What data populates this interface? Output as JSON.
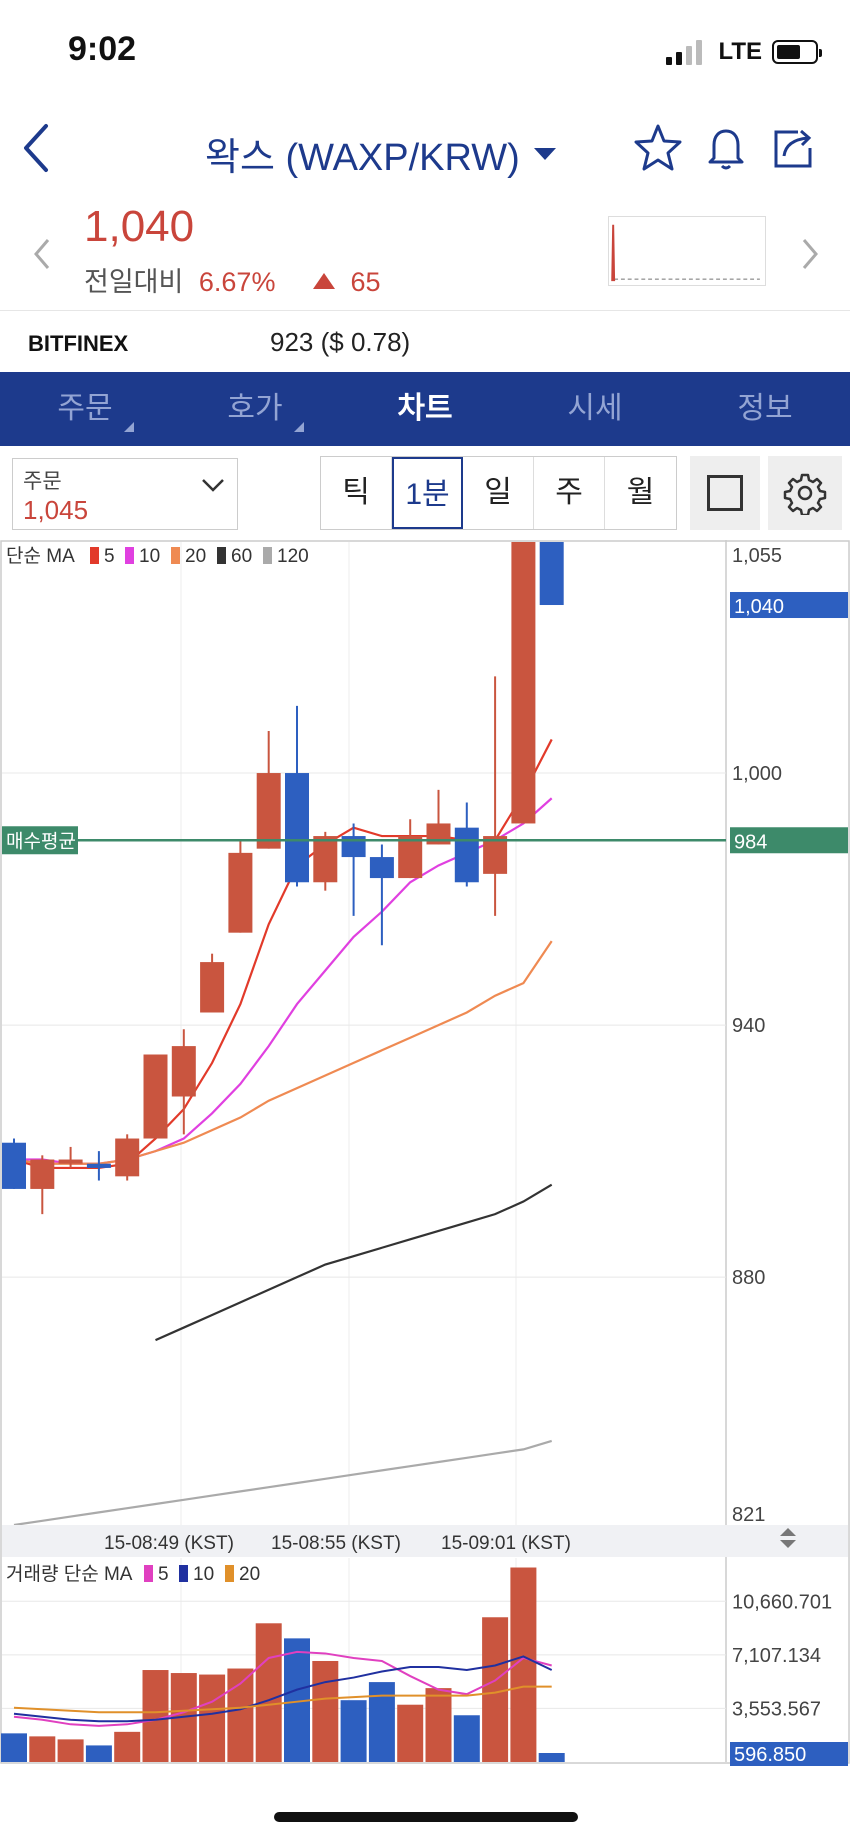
{
  "status": {
    "time": "9:02",
    "network": "LTE"
  },
  "header": {
    "title": "왁스 (WAXP/KRW)"
  },
  "quote": {
    "price": "1,040",
    "change_label": "전일대비",
    "change_pct": "6.67%",
    "change_abs": "65"
  },
  "exchange": {
    "name": "BITFINEX",
    "value": "923 ($ 0.78)"
  },
  "tabs": [
    {
      "label": "주문"
    },
    {
      "label": "호가"
    },
    {
      "label": "차트"
    },
    {
      "label": "시세"
    },
    {
      "label": "정보"
    }
  ],
  "order_box": {
    "label": "주문",
    "value": "1,045"
  },
  "periods": [
    "틱",
    "1분",
    "일",
    "주",
    "월"
  ],
  "selected_period": "1분",
  "colors": {
    "up": "#c9553f",
    "down": "#2d5fc0",
    "brand": "#1d3a8c",
    "avg": "#3d8a6a"
  },
  "chart_data": [
    {
      "type": "candlestick",
      "legend_title": "단순 MA",
      "ma_legend": [
        {
          "name": "5",
          "color": "#e23a2a"
        },
        {
          "name": "10",
          "color": "#e040e0"
        },
        {
          "name": "20",
          "color": "#ef8a52"
        },
        {
          "name": "60",
          "color": "#333333"
        },
        {
          "name": "120",
          "color": "#aaaaaa"
        }
      ],
      "ylim": [
        821,
        1055
      ],
      "yticks": [
        "1,055",
        "1,000",
        "940",
        "880",
        "821"
      ],
      "current_price_label": "1,040",
      "avg_price": {
        "label": "매수평균",
        "value": 984,
        "tag": "984"
      },
      "xticks": [
        "15-08:49 (KST)",
        "15-08:55 (KST)",
        "15-09:01 (KST)"
      ],
      "candles": [
        {
          "o": 912,
          "c": 901,
          "h": 913,
          "l": 901
        },
        {
          "o": 901,
          "c": 908,
          "h": 909,
          "l": 895
        },
        {
          "o": 907,
          "c": 908,
          "h": 911,
          "l": 906
        },
        {
          "o": 907,
          "c": 906,
          "h": 910,
          "l": 903
        },
        {
          "o": 904,
          "c": 913,
          "h": 914,
          "l": 903
        },
        {
          "o": 913,
          "c": 933,
          "h": 933,
          "l": 913
        },
        {
          "o": 923,
          "c": 935,
          "h": 939,
          "l": 914
        },
        {
          "o": 943,
          "c": 955,
          "h": 957,
          "l": 943
        },
        {
          "o": 962,
          "c": 981,
          "h": 984,
          "l": 962
        },
        {
          "o": 982,
          "c": 1000,
          "h": 1010,
          "l": 982
        },
        {
          "o": 1000,
          "c": 974,
          "h": 1016,
          "l": 973
        },
        {
          "o": 974,
          "c": 985,
          "h": 986,
          "l": 972
        },
        {
          "o": 985,
          "c": 980,
          "h": 988,
          "l": 966
        },
        {
          "o": 980,
          "c": 975,
          "h": 983,
          "l": 959
        },
        {
          "o": 975,
          "c": 985,
          "h": 989,
          "l": 975
        },
        {
          "o": 983,
          "c": 988,
          "h": 996,
          "l": 983
        },
        {
          "o": 987,
          "c": 974,
          "h": 993,
          "l": 973
        },
        {
          "o": 976,
          "c": 985,
          "h": 1023,
          "l": 966
        },
        {
          "o": 988,
          "c": 1055,
          "h": 1055,
          "l": 988
        },
        {
          "o": 1055,
          "c": 1040,
          "h": 1055,
          "l": 1040
        }
      ],
      "ma": [
        {
          "name": "5",
          "color": "#e23a2a",
          "values": [
            908,
            906,
            906,
            906,
            907,
            913,
            920,
            931,
            945,
            964,
            978,
            983,
            987,
            985,
            985,
            985,
            984,
            984,
            995,
            1008
          ]
        },
        {
          "name": "10",
          "color": "#e040e0",
          "values": [
            908,
            908,
            907,
            907,
            908,
            910,
            913,
            919,
            926,
            935,
            945,
            953,
            961,
            967,
            974,
            978,
            981,
            984,
            988,
            994
          ]
        },
        {
          "name": "20",
          "color": "#ef8a52",
          "values": [
            908,
            907,
            907,
            907,
            908,
            910,
            912,
            915,
            918,
            922,
            925,
            928,
            931,
            934,
            937,
            940,
            943,
            947,
            950,
            960
          ]
        },
        {
          "name": "60",
          "color": "#333333",
          "values": [
            854,
            856,
            858,
            860,
            862,
            865,
            868,
            871,
            874,
            877,
            880,
            883,
            885,
            887,
            889,
            891,
            893,
            895,
            898,
            902
          ]
        },
        {
          "name": "120",
          "color": "#aaaaaa",
          "values": [
            821,
            822,
            823,
            824,
            825,
            826,
            827,
            828,
            829,
            830,
            831,
            832,
            833,
            834,
            835,
            836,
            837,
            838,
            839,
            841
          ]
        }
      ]
    },
    {
      "type": "bar",
      "legend_title": "거래량 단순 MA",
      "ma_legend": [
        {
          "name": "5",
          "color": "#e040c0"
        },
        {
          "name": "10",
          "color": "#2030a0"
        },
        {
          "name": "20",
          "color": "#e0902a"
        }
      ],
      "ylim": [
        0,
        13000
      ],
      "yticks": [
        "10,660.701",
        "7,107.134",
        "3,553.567"
      ],
      "current_label": "596.850",
      "values": [
        1900,
        1700,
        1500,
        1100,
        2000,
        6100,
        5900,
        5800,
        6200,
        9200,
        8200,
        6700,
        4100,
        5300,
        3800,
        4900,
        3100,
        9600,
        12900,
        597
      ],
      "up": [
        false,
        true,
        true,
        false,
        true,
        true,
        true,
        true,
        true,
        true,
        false,
        true,
        false,
        false,
        true,
        true,
        false,
        true,
        true,
        false
      ],
      "ma": [
        {
          "name": "5",
          "color": "#e040c0",
          "values": [
            3000,
            2800,
            2500,
            2400,
            2500,
            2800,
            3300,
            4000,
            5200,
            6900,
            7300,
            7200,
            6900,
            6700,
            5700,
            4800,
            4500,
            5400,
            6900,
            6400
          ]
        },
        {
          "name": "10",
          "color": "#2030a0",
          "values": [
            3200,
            3000,
            2800,
            2700,
            2700,
            2800,
            3000,
            3200,
            3500,
            4100,
            4800,
            5300,
            5600,
            6000,
            6300,
            6300,
            6100,
            6400,
            7000,
            6100
          ]
        },
        {
          "name": "20",
          "color": "#e0902a",
          "values": [
            3600,
            3500,
            3400,
            3300,
            3300,
            3300,
            3400,
            3500,
            3600,
            3800,
            4000,
            4200,
            4300,
            4400,
            4400,
            4400,
            4400,
            4600,
            5000,
            5000
          ]
        }
      ]
    }
  ]
}
